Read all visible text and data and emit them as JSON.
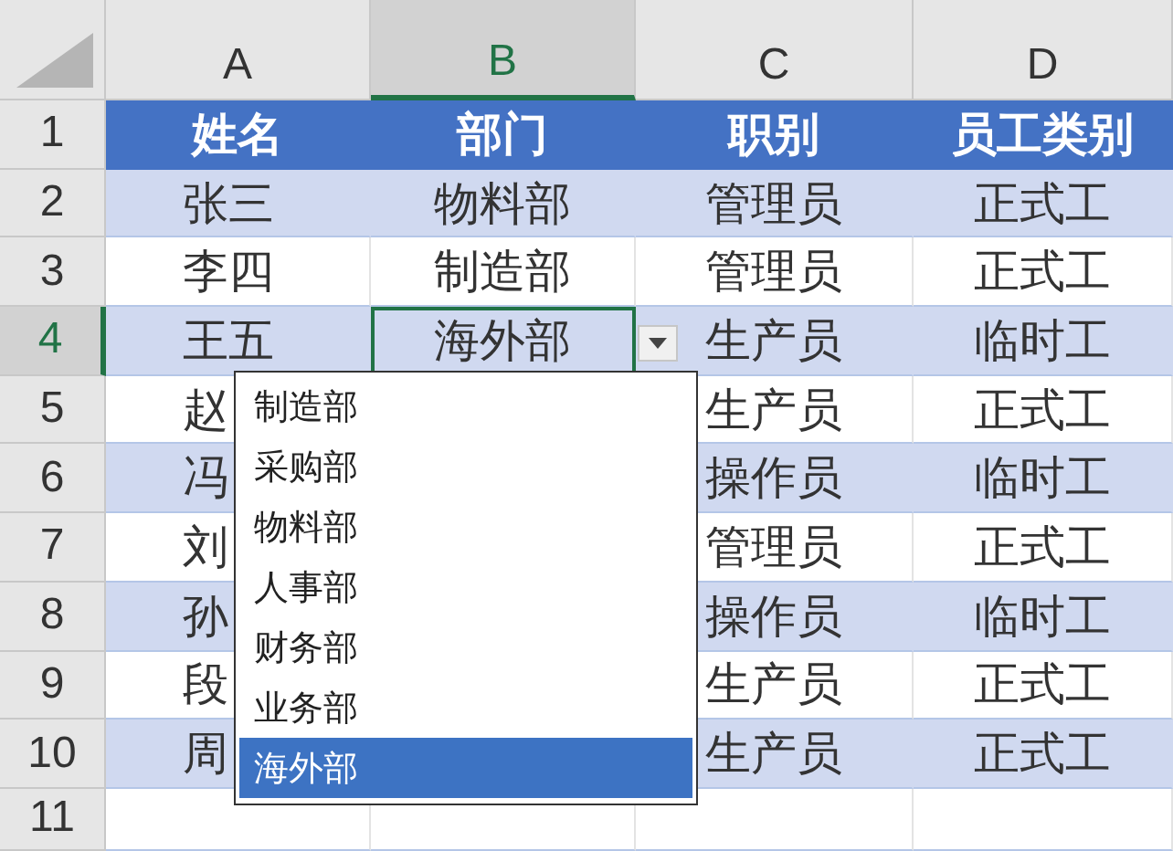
{
  "columns": [
    {
      "label": "A",
      "selected": false
    },
    {
      "label": "B",
      "selected": true
    },
    {
      "label": "C",
      "selected": false
    },
    {
      "label": "D",
      "selected": false
    }
  ],
  "rows": [
    {
      "number": "1",
      "kind": "header",
      "banded": false,
      "selected": false,
      "cells": [
        "姓名",
        "部门",
        "职别",
        "员工类别"
      ]
    },
    {
      "number": "2",
      "kind": "data",
      "banded": true,
      "selected": false,
      "cells": [
        "张三",
        "物料部",
        "管理员",
        "正式工"
      ]
    },
    {
      "number": "3",
      "kind": "data",
      "banded": false,
      "selected": false,
      "cells": [
        "李四",
        "制造部",
        "管理员",
        "正式工"
      ]
    },
    {
      "number": "4",
      "kind": "data",
      "banded": true,
      "selected": true,
      "cells": [
        "王五",
        "海外部",
        "生产员",
        "临时工"
      ]
    },
    {
      "number": "5",
      "kind": "data",
      "banded": false,
      "selected": false,
      "cells": [
        "赵",
        null,
        "生产员",
        "正式工"
      ]
    },
    {
      "number": "6",
      "kind": "data",
      "banded": true,
      "selected": false,
      "cells": [
        "冯",
        null,
        "操作员",
        "临时工"
      ]
    },
    {
      "number": "7",
      "kind": "data",
      "banded": false,
      "selected": false,
      "cells": [
        "刘",
        null,
        "管理员",
        "正式工"
      ]
    },
    {
      "number": "8",
      "kind": "data",
      "banded": true,
      "selected": false,
      "cells": [
        "孙",
        null,
        "操作员",
        "临时工"
      ]
    },
    {
      "number": "9",
      "kind": "data",
      "banded": false,
      "selected": false,
      "cells": [
        "段",
        null,
        "生产员",
        "正式工"
      ]
    },
    {
      "number": "10",
      "kind": "data",
      "banded": true,
      "selected": false,
      "cells": [
        "周",
        null,
        "生产员",
        "正式工"
      ]
    },
    {
      "number": "11",
      "kind": "data",
      "banded": false,
      "selected": false,
      "cells": []
    }
  ],
  "dropdown": {
    "items": [
      {
        "label": "制造部",
        "selected": false
      },
      {
        "label": "采购部",
        "selected": false
      },
      {
        "label": "物料部",
        "selected": false
      },
      {
        "label": "人事部",
        "selected": false
      },
      {
        "label": "财务部",
        "selected": false
      },
      {
        "label": "业务部",
        "selected": false
      },
      {
        "label": "海外部",
        "selected": true
      }
    ]
  }
}
